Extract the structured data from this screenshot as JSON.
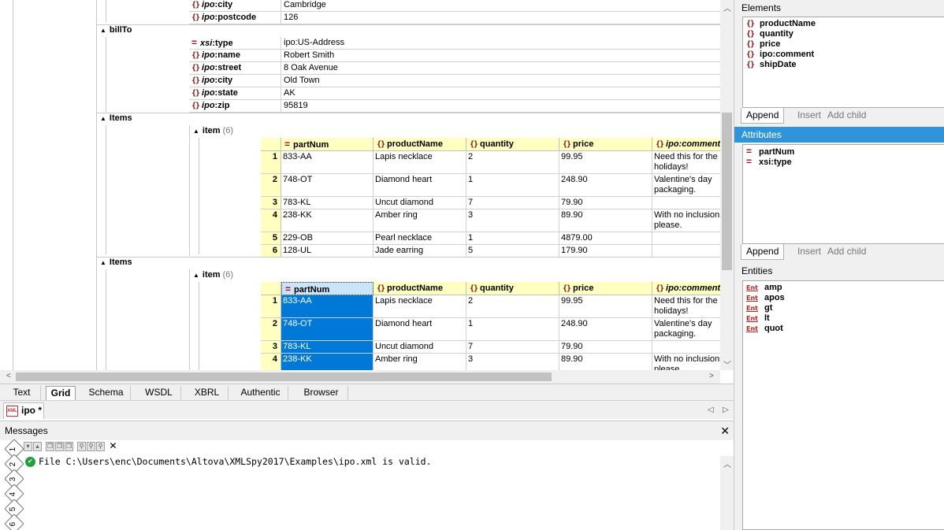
{
  "grid": {
    "ship_rows": [
      {
        "ns": "ipo",
        "name": "city",
        "value": "Cambridge"
      },
      {
        "ns": "ipo",
        "name": "postcode",
        "value": "126"
      }
    ],
    "billto": {
      "label": "billTo",
      "rows": [
        {
          "kind": "attr",
          "ns": "xsi",
          "name": "type",
          "value": "ipo:US-Address"
        },
        {
          "kind": "elem",
          "ns": "ipo",
          "name": "name",
          "value": "Robert Smith"
        },
        {
          "kind": "elem",
          "ns": "ipo",
          "name": "street",
          "value": "8 Oak Avenue"
        },
        {
          "kind": "elem",
          "ns": "ipo",
          "name": "city",
          "value": "Old Town"
        },
        {
          "kind": "elem",
          "ns": "ipo",
          "name": "state",
          "value": "AK"
        },
        {
          "kind": "elem",
          "ns": "ipo",
          "name": "zip",
          "value": "95819"
        }
      ]
    },
    "items_label": "Items",
    "item_label": "item",
    "item_count": "(6)",
    "columns": [
      "partNum",
      "productName",
      "quantity",
      "price",
      "ipo:comment"
    ],
    "rows": [
      {
        "n": "1",
        "partNum": "833-AA",
        "productName": "Lapis necklace",
        "quantity": "2",
        "price": "99.95",
        "comment": "Need this for the holidays!"
      },
      {
        "n": "2",
        "partNum": "748-OT",
        "productName": "Diamond heart",
        "quantity": "1",
        "price": "248.90",
        "comment": "Valentine's day packaging."
      },
      {
        "n": "3",
        "partNum": "783-KL",
        "productName": "Uncut diamond",
        "quantity": "7",
        "price": "79.90",
        "comment": ""
      },
      {
        "n": "4",
        "partNum": "238-KK",
        "productName": "Amber ring",
        "quantity": "3",
        "price": "89.90",
        "comment": "With no inclusions, please."
      },
      {
        "n": "5",
        "partNum": "229-OB",
        "productName": "Pearl necklace",
        "quantity": "1",
        "price": "4879.00",
        "comment": ""
      },
      {
        "n": "6",
        "partNum": "128-UL",
        "productName": "Jade earring",
        "quantity": "5",
        "price": "179.90",
        "comment": ""
      }
    ]
  },
  "view_tabs": [
    "Text",
    "Grid",
    "Schema",
    "WSDL",
    "XBRL",
    "Authentic",
    "Browser"
  ],
  "active_view": "Grid",
  "doc_tab": {
    "title": "ipo *",
    "icon_text": "XML"
  },
  "messages": {
    "title": "Messages",
    "text": "File C:\\Users\\enc\\Documents\\Altova\\XMLSpy2017\\Examples\\ipo.xml is valid.",
    "side_tabs": [
      "1",
      "2",
      "3",
      "4",
      "5",
      "6"
    ]
  },
  "elements_panel": {
    "title": "Elements",
    "items": [
      "productName",
      "quantity",
      "price",
      "ipo:comment",
      "shipDate"
    ],
    "tabs": [
      "Append",
      "Insert",
      "Add child"
    ]
  },
  "attributes_panel": {
    "title": "Attributes",
    "items": [
      "partNum",
      "xsi:type"
    ],
    "tabs": [
      "Append",
      "Insert",
      "Add child"
    ]
  },
  "entities_panel": {
    "title": "Entities",
    "icon_text": "Ent",
    "items": [
      "amp",
      "apos",
      "gt",
      "lt",
      "quot"
    ]
  },
  "colors": {
    "selection": "#0078d7",
    "header_yellow": "#ffffc0",
    "panel_header_blue": "#2f95d8"
  }
}
